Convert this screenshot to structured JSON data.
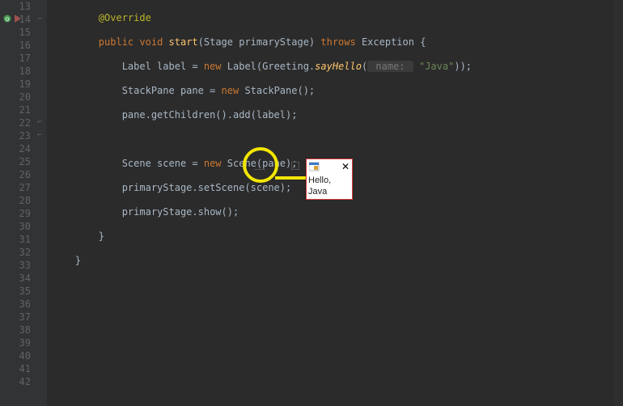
{
  "gutter": {
    "lines": [
      "13",
      "14",
      "15",
      "16",
      "17",
      "18",
      "19",
      "20",
      "21",
      "22",
      "23",
      "24",
      "25",
      "26",
      "27",
      "28",
      "29",
      "30",
      "31",
      "32",
      "33",
      "34",
      "35",
      "36",
      "37",
      "38",
      "39",
      "40",
      "41",
      "42"
    ]
  },
  "code": {
    "l13": {
      "indent": "        ",
      "annotation": "@Override"
    },
    "l14": {
      "indent": "        ",
      "kw1": "public",
      "kw2": "void",
      "meth": "start",
      "p1": "(Stage primaryStage) ",
      "kw3": "throws",
      "p2": " Exception {"
    },
    "l15": {
      "indent": "            ",
      "t1": "Label label = ",
      "kw": "new",
      "t2": " Label(Greeting.",
      "methi": "sayHello",
      "p1": "(",
      "hint": " name: ",
      "str": "\"Java\"",
      "p2": "));"
    },
    "l16": {
      "indent": "            ",
      "t1": "StackPane pane = ",
      "kw": "new",
      "t2": " StackPane();"
    },
    "l17": {
      "indent": "            ",
      "t1": "pane.getChildren().add(label);"
    },
    "l18": {
      "indent": ""
    },
    "l19": {
      "indent": "            ",
      "t1": "Scene scene = ",
      "kw": "new",
      "t2": " Scene(pane);"
    },
    "l20": {
      "indent": "            ",
      "t1": "primaryStage.setScene(scene);"
    },
    "l21": {
      "indent": "            ",
      "t1": "primaryStage.show();"
    },
    "l22": {
      "indent": "        ",
      "brace": "}"
    },
    "l23": {
      "indent": "    ",
      "brace": "}"
    }
  },
  "popup": {
    "body_text": "Hello, Java",
    "close_glyph": "✕"
  },
  "window_controls": {
    "minimize": "—"
  }
}
